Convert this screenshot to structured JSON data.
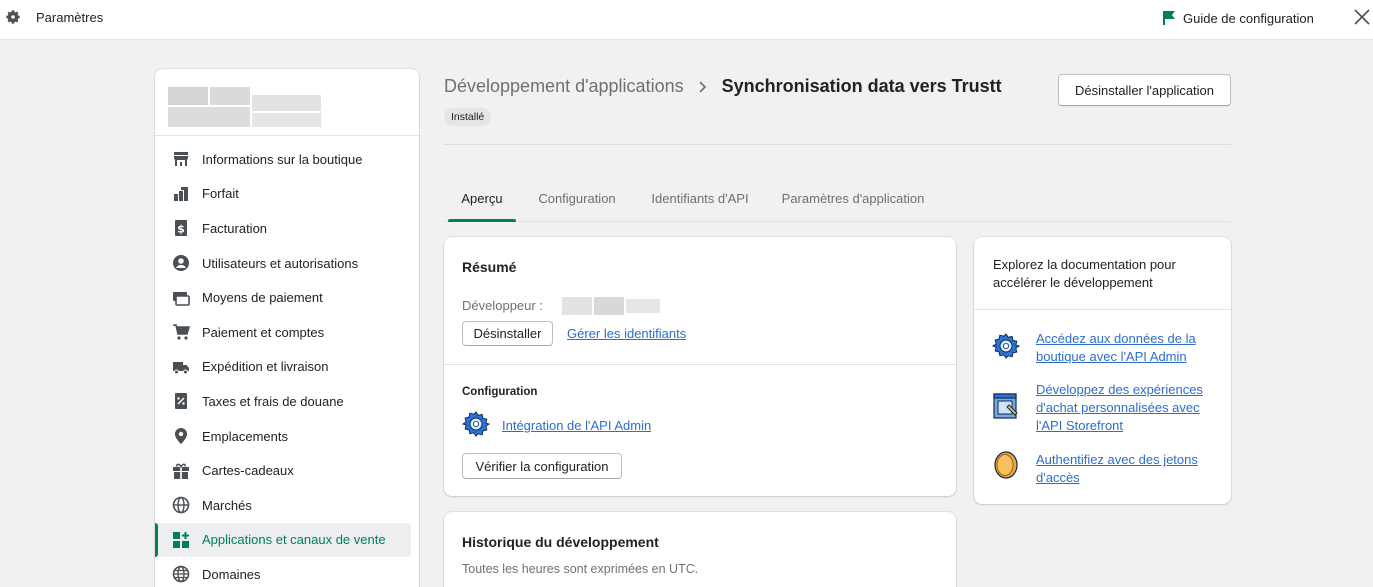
{
  "topbar": {
    "title": "Paramètres",
    "guide_label": "Guide de configuration",
    "colors": {
      "flag": "#008060"
    }
  },
  "sidebar": {
    "items": [
      {
        "label": "Informations sur la boutique",
        "icon": "store-icon",
        "active": false
      },
      {
        "label": "Forfait",
        "icon": "plan-icon",
        "active": false
      },
      {
        "label": "Facturation",
        "icon": "billing-icon",
        "active": false
      },
      {
        "label": "Utilisateurs et autorisations",
        "icon": "user-circle-icon",
        "active": false
      },
      {
        "label": "Moyens de paiement",
        "icon": "payment-card-icon",
        "active": false
      },
      {
        "label": "Paiement et comptes",
        "icon": "cart-icon",
        "active": false
      },
      {
        "label": "Expédition et livraison",
        "icon": "truck-icon",
        "active": false
      },
      {
        "label": "Taxes et frais de douane",
        "icon": "tax-icon",
        "active": false
      },
      {
        "label": "Emplacements",
        "icon": "location-pin-icon",
        "active": false
      },
      {
        "label": "Cartes-cadeaux",
        "icon": "gift-icon",
        "active": false
      },
      {
        "label": "Marchés",
        "icon": "globe-icon",
        "active": false
      },
      {
        "label": "Applications et canaux de vente",
        "icon": "apps-icon",
        "active": true
      },
      {
        "label": "Domaines",
        "icon": "domain-globe-icon",
        "active": false
      }
    ]
  },
  "page": {
    "breadcrumb_parent": "Développement d'applications",
    "breadcrumb_current": "Synchronisation data vers Trustt",
    "badge": "Installé",
    "uninstall_app_label": "Désinstaller l'application"
  },
  "tabs": [
    {
      "label": "Aperçu",
      "active": true
    },
    {
      "label": "Configuration",
      "active": false
    },
    {
      "label": "Identifiants d'API",
      "active": false
    },
    {
      "label": "Paramètres d'application",
      "active": false
    }
  ],
  "summary": {
    "title": "Résumé",
    "developer_label": "Développeur :",
    "uninstall_label": "Désinstaller",
    "manage_credentials_link": "Gérer les identifiants",
    "config_heading": "Configuration",
    "admin_api_link": "Intégration de l'API Admin",
    "verify_label": "Vérifier la configuration"
  },
  "history": {
    "title": "Historique du développement",
    "subtitle": "Toutes les heures sont exprimées en UTC."
  },
  "docs": {
    "intro": "Explorez la documentation pour accélérer le développement",
    "links": [
      {
        "label": "Accédez aux données de la boutique avec l'API Admin",
        "icon": "gear-api-icon"
      },
      {
        "label": "Développez des expériences d'achat personnalisées avec l'API Storefront",
        "icon": "storefront-window-icon"
      },
      {
        "label": "Authentifiez avec des jetons d'accès",
        "icon": "token-coin-icon"
      }
    ]
  },
  "colors": {
    "accent": "#008060",
    "link": "#2c6ecb",
    "active_text": "#007f5f"
  }
}
